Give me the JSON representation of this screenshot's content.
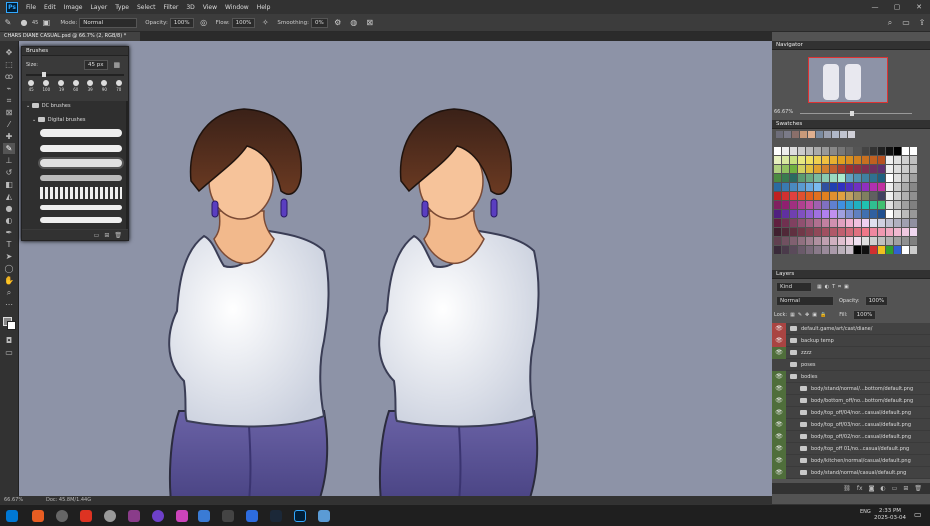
{
  "menu": {
    "logo": "Ps",
    "items": [
      "File",
      "Edit",
      "Image",
      "Layer",
      "Type",
      "Select",
      "Filter",
      "3D",
      "View",
      "Window",
      "Help"
    ]
  },
  "options": {
    "brush_size": "45",
    "mode_label": "Mode:",
    "mode_value": "Normal",
    "opacity_label": "Opacity:",
    "opacity_value": "100%",
    "flow_label": "Flow:",
    "flow_value": "100%",
    "smoothing_label": "Smoothing:",
    "smoothing_value": "0%"
  },
  "document": {
    "tab_title": "CHARS DIANE CASUAL.psd @ 66.7% (2, RGB/8) *",
    "zoom": "66.67%",
    "doc_size": "Doc: 45.8M/1.44G"
  },
  "brushes": {
    "title": "Brushes",
    "size_label": "Size:",
    "size_value": "45 px",
    "presets": [
      "45",
      "100",
      "19",
      "60",
      "39",
      "90",
      "70"
    ],
    "group1": "DC brushes",
    "group2": "Digital brushes"
  },
  "navigator": {
    "title": "Navigator",
    "zoom": "66.67%"
  },
  "swatches": {
    "title": "Swatches"
  },
  "layers": {
    "title": "Layers",
    "kind_label": "Kind",
    "blend": "Normal",
    "opacity_label": "Opacity:",
    "opacity_value": "100%",
    "lock_label": "Lock:",
    "fill_label": "Fill:",
    "fill_value": "100%",
    "rows": [
      {
        "name": "default.game/art/cast/diane/",
        "eye": "red"
      },
      {
        "name": "backup temp",
        "eye": "red"
      },
      {
        "name": "zzzz",
        "eye": "green"
      },
      {
        "name": "poses",
        "eye": "none"
      },
      {
        "name": "bodies",
        "eye": "green"
      },
      {
        "name": "body/stand/normal/...bottom/default.png",
        "eye": "green"
      },
      {
        "name": "body/bottom_off/no...bottom/default.png",
        "eye": "green"
      },
      {
        "name": "body/top_off/04/nor...casual/default.png",
        "eye": "green"
      },
      {
        "name": "body/top_off/03/nor...casual/default.png",
        "eye": "green"
      },
      {
        "name": "body/top_off/02/nor...casual/default.png",
        "eye": "green"
      },
      {
        "name": "body/top_off 01/no...casual/default.png",
        "eye": "green"
      },
      {
        "name": "body/kitchen/normal/casual/default.png",
        "eye": "green"
      },
      {
        "name": "body/stand/normal/casual/default.png",
        "eye": "green"
      }
    ]
  },
  "taskbar": {
    "time": "2:33 PM",
    "date": "2025-03-04",
    "lang": "ENG"
  }
}
